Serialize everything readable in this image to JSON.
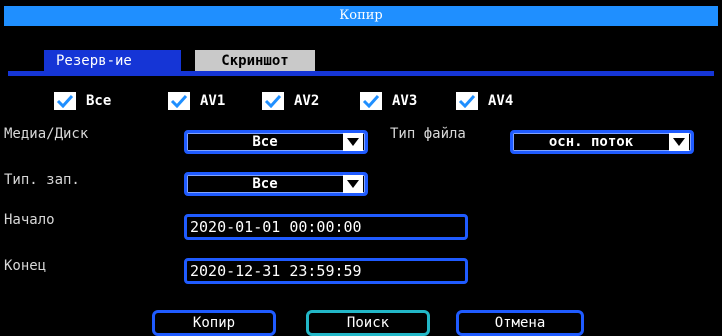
{
  "window": {
    "title": "Копир"
  },
  "tabs": [
    {
      "label": "Резерв-ие",
      "active": true
    },
    {
      "label": "Скриншот",
      "active": false
    }
  ],
  "channels": [
    {
      "label": "Все",
      "checked": true
    },
    {
      "label": "AV1",
      "checked": true
    },
    {
      "label": "AV2",
      "checked": true
    },
    {
      "label": "AV3",
      "checked": true
    },
    {
      "label": "AV4",
      "checked": true
    }
  ],
  "form": {
    "media_label": "Медиа/Диск",
    "media_value": "Все",
    "filetype_label": "Тип файла",
    "filetype_value": "осн. поток",
    "rectype_label": "Тип. зап.",
    "rectype_value": "Все",
    "start_label": "Начало",
    "start_value": "2020-01-01 00:00:00",
    "end_label": "Конец",
    "end_value": "2020-12-31 23:59:59"
  },
  "buttons": {
    "copy": "Копир",
    "search": "Поиск",
    "cancel": "Отмена"
  },
  "colors": {
    "accent": "#1f5bff",
    "title_bar": "#1f8fff",
    "tab_active": "#1535d6",
    "focus": "#22b7c7"
  }
}
